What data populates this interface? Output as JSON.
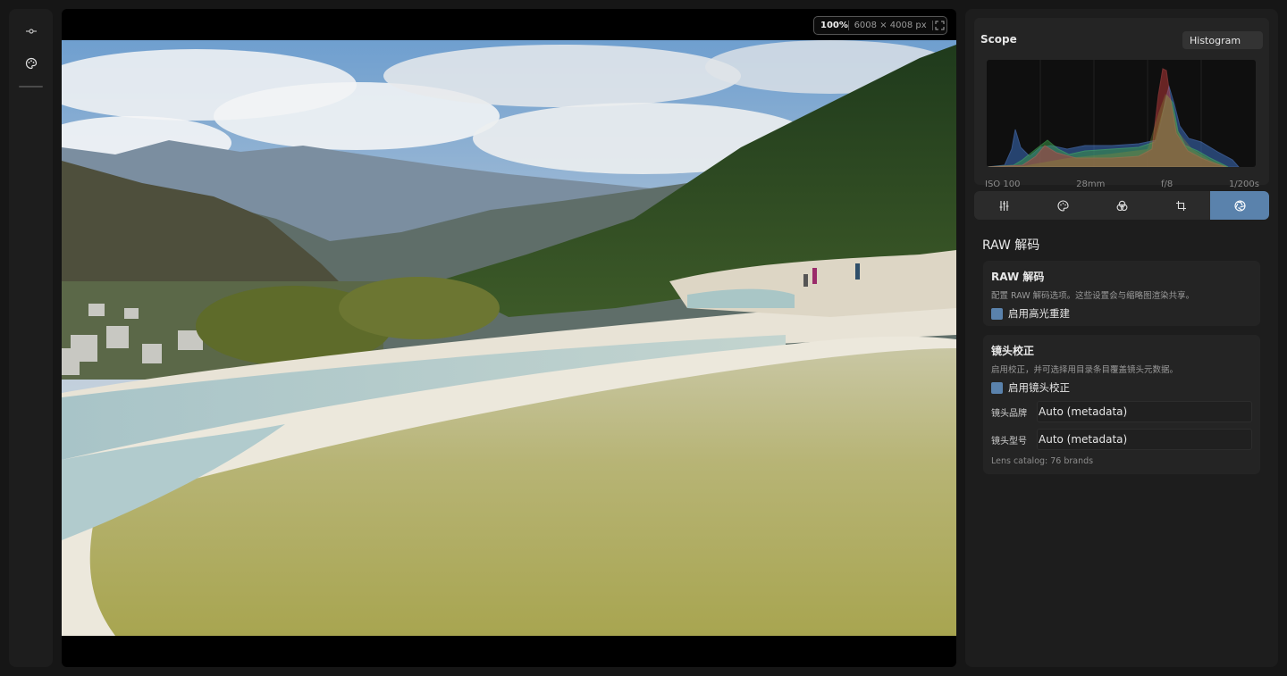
{
  "rail": {
    "icons": [
      "adjust-slider-icon",
      "palette-icon"
    ]
  },
  "viewer": {
    "zoom": "100%",
    "dimensions": "6008 × 4008 px",
    "fit_icon": "fullscreen-icon"
  },
  "scope": {
    "title": "Scope",
    "mode": "Histogram",
    "exif": {
      "iso": "ISO 100",
      "focal": "28mm",
      "aperture": "f/8",
      "shutter": "1/200s"
    }
  },
  "tabs": [
    {
      "icon": "sliders-icon",
      "active": false
    },
    {
      "icon": "palette-icon",
      "active": false
    },
    {
      "icon": "color-mixer-icon",
      "active": false
    },
    {
      "icon": "crop-icon",
      "active": false
    },
    {
      "icon": "aperture-icon",
      "active": true
    }
  ],
  "section": {
    "title": "RAW 解码"
  },
  "raw_card": {
    "title": "RAW 解码",
    "description": "配置 RAW 解码选项。这些设置会与缩略图渲染共享。",
    "checkbox_label": "启用高光重建",
    "checked": true
  },
  "lens_card": {
    "title": "镜头校正",
    "description": "启用校正，并可选择用目录条目覆盖镜头元数据。",
    "checkbox_label": "启用镜头校正",
    "checked": true,
    "brand_label": "镜头品牌",
    "brand_value": "Auto (metadata)",
    "model_label": "镜头型号",
    "model_value": "Auto (metadata)",
    "catalog": "Lens catalog: 76 brands"
  },
  "colors": {
    "accent": "#5a82ac",
    "background": "#161616",
    "panel": "#1d1d1d",
    "card": "#242424"
  }
}
